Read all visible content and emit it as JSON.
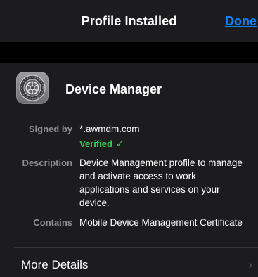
{
  "header": {
    "title": "Profile Installed",
    "done_label": "Done"
  },
  "profile": {
    "name": "Device Manager",
    "icon": "settings-gear-icon"
  },
  "details": {
    "signed_by_label": "Signed by",
    "signed_by_value": "*.awmdm.com",
    "verified_label": "Verified",
    "verified_icon": "✓",
    "description_label": "Description",
    "description_value": "Device Management profile to manage and activate access to work applications and services on your device.",
    "contains_label": "Contains",
    "contains_value": "Mobile Device Management Certificate"
  },
  "more_details": {
    "label": "More Details",
    "chevron": "›"
  },
  "colors": {
    "accent": "#0a84ff",
    "verified": "#30d158",
    "background": "#1c1c1e",
    "secondary_text": "#8e8e93"
  }
}
